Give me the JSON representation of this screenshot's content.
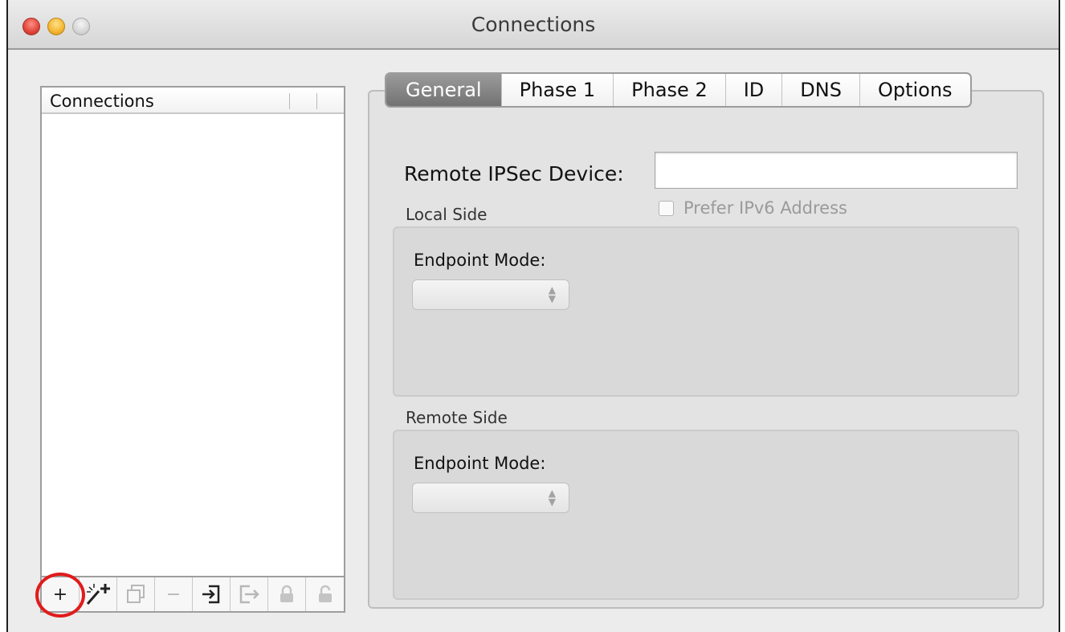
{
  "window": {
    "title": "Connections"
  },
  "sidebar": {
    "header": "Connections",
    "toolbar": [
      {
        "id": "add",
        "glyph": "+",
        "enabled": true,
        "highlighted": true
      },
      {
        "id": "wizard",
        "glyph": "⚚",
        "enabled": true
      },
      {
        "id": "duplicate",
        "glyph": "⧉",
        "enabled": false
      },
      {
        "id": "remove",
        "glyph": "−",
        "enabled": false
      },
      {
        "id": "import",
        "glyph": "⇥",
        "enabled": true
      },
      {
        "id": "export",
        "glyph": "⇨",
        "enabled": false
      },
      {
        "id": "lock",
        "glyph": "🔒",
        "enabled": false
      },
      {
        "id": "unlock",
        "glyph": "🔓",
        "enabled": false
      }
    ]
  },
  "tabs": [
    {
      "label": "General",
      "active": true
    },
    {
      "label": "Phase 1",
      "active": false
    },
    {
      "label": "Phase 2",
      "active": false
    },
    {
      "label": "ID",
      "active": false
    },
    {
      "label": "DNS",
      "active": false
    },
    {
      "label": "Options",
      "active": false
    }
  ],
  "general": {
    "remote_device_label": "Remote IPSec Device:",
    "remote_device_value": "",
    "prefer_ipv6_label": "Prefer IPv6 Address",
    "prefer_ipv6_checked": false,
    "local_side": {
      "label": "Local Side",
      "endpoint_label": "Endpoint Mode:",
      "endpoint_value": ""
    },
    "remote_side": {
      "label": "Remote Side",
      "endpoint_label": "Endpoint Mode:",
      "endpoint_value": ""
    }
  },
  "colors": {
    "highlight": "#e11b1b",
    "active_tab": "#7c7c7c"
  }
}
